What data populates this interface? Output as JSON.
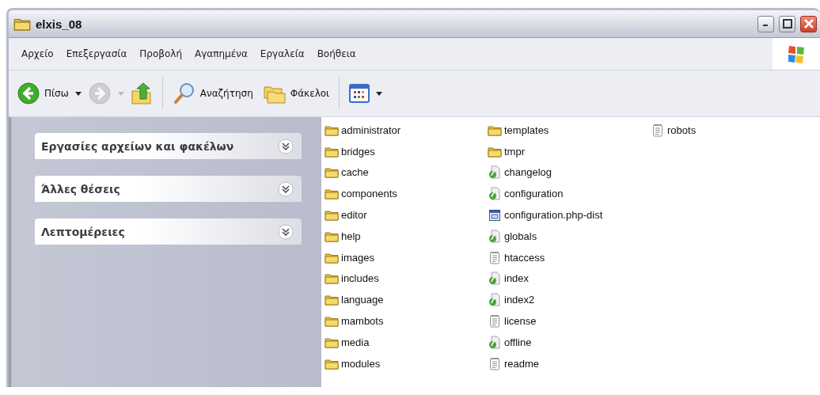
{
  "window": {
    "title": "elxis_08"
  },
  "menu": [
    "Αρχείο",
    "Επεξεργασία",
    "Προβολή",
    "Αγαπημένα",
    "Εργαλεία",
    "Βοήθεια"
  ],
  "toolbar": [
    {
      "kind": "back",
      "label": "Πίσω",
      "disabled": false
    },
    {
      "kind": "forward",
      "disabled": true
    },
    {
      "kind": "up",
      "disabled": false
    },
    {
      "kind": "search",
      "label": "Αναζήτηση",
      "disabled": false
    },
    {
      "kind": "folders",
      "label": "Φάκελοι",
      "disabled": false
    },
    {
      "kind": "views",
      "disabled": false
    }
  ],
  "task_panel": [
    {
      "title": "Εργασίες αρχείων και φακέλων",
      "expanded": false
    },
    {
      "title": "Άλλες θέσεις",
      "expanded": false
    },
    {
      "title": "Λεπτομέρειες",
      "expanded": false
    }
  ],
  "files": [
    {
      "name": "administrator",
      "kind": "folder"
    },
    {
      "name": "bridges",
      "kind": "folder"
    },
    {
      "name": "cache",
      "kind": "folder"
    },
    {
      "name": "components",
      "kind": "folder"
    },
    {
      "name": "editor",
      "kind": "folder"
    },
    {
      "name": "help",
      "kind": "folder"
    },
    {
      "name": "images",
      "kind": "folder"
    },
    {
      "name": "includes",
      "kind": "folder"
    },
    {
      "name": "language",
      "kind": "folder"
    },
    {
      "name": "mambots",
      "kind": "folder"
    },
    {
      "name": "media",
      "kind": "folder"
    },
    {
      "name": "modules",
      "kind": "folder"
    },
    {
      "name": "templates",
      "kind": "folder"
    },
    {
      "name": "tmpr",
      "kind": "folder"
    },
    {
      "name": "changelog",
      "kind": "php"
    },
    {
      "name": "configuration",
      "kind": "php"
    },
    {
      "name": "configuration.php-dist",
      "kind": "config"
    },
    {
      "name": "globals",
      "kind": "php"
    },
    {
      "name": "htaccess",
      "kind": "text"
    },
    {
      "name": "index",
      "kind": "php"
    },
    {
      "name": "index2",
      "kind": "php"
    },
    {
      "name": "license",
      "kind": "text"
    },
    {
      "name": "offline",
      "kind": "php"
    },
    {
      "name": "readme",
      "kind": "text"
    },
    {
      "name": "robots",
      "kind": "text"
    }
  ]
}
